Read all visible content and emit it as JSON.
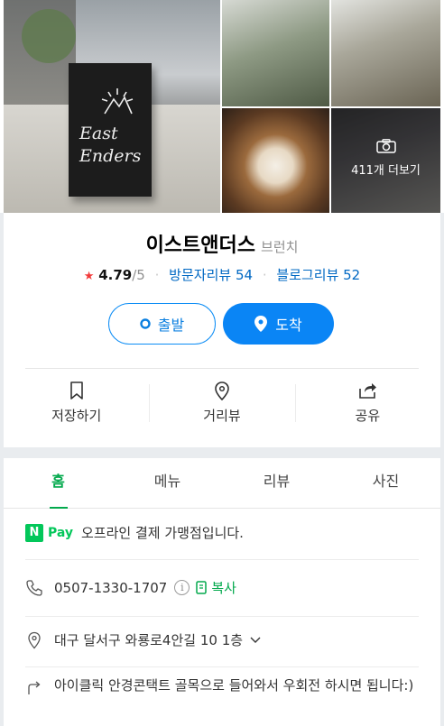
{
  "gallery": {
    "sign_line1": "East",
    "sign_line2": "Enders",
    "more_label": "411개 더보기",
    "camera_icon": "camera-icon"
  },
  "place": {
    "name": "이스트앤더스",
    "category": "브런치",
    "rating_star": "★",
    "rating": "4.79",
    "rating_max": "/5",
    "visitor_reviews_label": "방문자리뷰 54",
    "blog_reviews_label": "블로그리뷰 52"
  },
  "buttons": {
    "start_label": "출발",
    "arrive_label": "도착"
  },
  "actions": [
    {
      "label": "저장하기",
      "icon": "bookmark-icon"
    },
    {
      "label": "거리뷰",
      "icon": "map-pin-outline-icon"
    },
    {
      "label": "공유",
      "icon": "share-icon"
    }
  ],
  "tabs": [
    {
      "label": "홈",
      "active": true
    },
    {
      "label": "메뉴",
      "active": false
    },
    {
      "label": "리뷰",
      "active": false
    },
    {
      "label": "사진",
      "active": false
    }
  ],
  "details": {
    "npay_badge": "N",
    "npay_text": "Pay",
    "npay_desc": "오프라인 결제 가맹점입니다.",
    "phone": "0507-1330-1707",
    "info_glyph": "i",
    "copy_label": "복사",
    "address": "대구 달서구 와룡로4안길 10 1층",
    "directions": "아이클릭 안경콘택트 골목으로 들어와서 우회전 하시면 됩니다:)"
  },
  "colors": {
    "naver_green": "#03c75a",
    "link_blue": "#0068c3",
    "route_blue": "#0a85f5",
    "star_red": "#f23a3a"
  }
}
